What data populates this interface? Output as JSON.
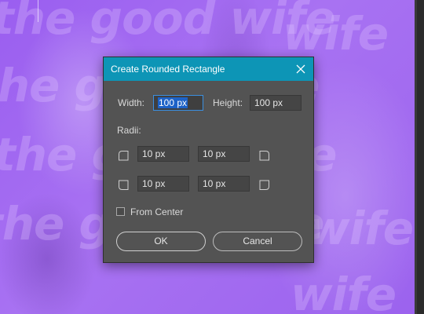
{
  "background": {
    "overlay_text": [
      "the good wife",
      "the good wife",
      "the good wife",
      "the good wife",
      "wife",
      "wife",
      "wife"
    ],
    "tint_color": "#a56bef"
  },
  "dialog": {
    "title": "Create Rounded Rectangle",
    "close_icon": "close-icon",
    "width_label": "Width:",
    "width_value": "100 px",
    "height_label": "Height:",
    "height_value": "100 px",
    "radii_label": "Radii:",
    "radii": {
      "top_left": "10 px",
      "top_right": "10 px",
      "bottom_left": "10 px",
      "bottom_right": "10 px"
    },
    "from_center_label": "From Center",
    "from_center_checked": false,
    "ok_label": "OK",
    "cancel_label": "Cancel",
    "accent_color": "#0d95b6",
    "selection_color": "#1d62c7"
  }
}
